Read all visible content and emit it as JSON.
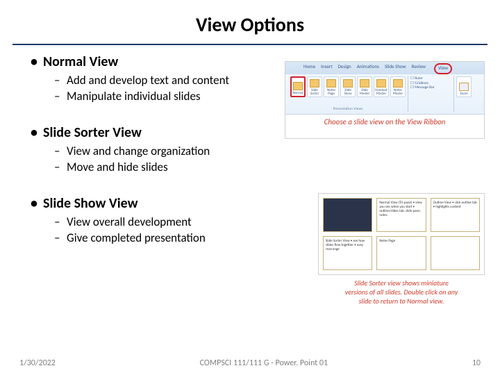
{
  "title": "View Options",
  "sections": [
    {
      "heading": "Normal View",
      "items": [
        "Add and develop text and content",
        "Manipulate individual slides"
      ]
    },
    {
      "heading": "Slide Sorter View",
      "items": [
        "View and change organization",
        "Move and hide slides"
      ]
    },
    {
      "heading": "Slide Show View",
      "items": [
        "View overall development",
        "Give completed presentation"
      ]
    }
  ],
  "ribbon": {
    "tabs": [
      "Home",
      "Insert",
      "Design",
      "Animations",
      "Slide Show",
      "Review",
      "View"
    ],
    "icons": [
      "Normal",
      "Slide Sorter",
      "Notes Page",
      "Slide Show",
      "Slide Master",
      "Handout Master",
      "Notes Master"
    ],
    "checks": [
      "Ruler",
      "Gridlines",
      "Message Bar"
    ],
    "zoom": "Zoom",
    "group_label": "Presentation Views",
    "caption": "Choose a slide view on the View Ribbon"
  },
  "sorter": {
    "slides": [
      "",
      "Normal View (Tri-pane)\n• view you see when you start\n• outline/slides tab, slide pane, notes",
      "Outline View\n• click outline tab\n• highlights content",
      "Slide Sorter View\n• see how slides flow together\n• easy rearrange",
      "Notes Page",
      ""
    ],
    "caption_line1": "Slide Sorter view shows miniature",
    "caption_line2": "versions of all slides. Double click on any",
    "caption_line3": "slide to return to Normal view."
  },
  "footer": {
    "date": "1/30/2022",
    "center": "COMPSCI 111/111 G - Power. Point 01",
    "page": "10"
  }
}
